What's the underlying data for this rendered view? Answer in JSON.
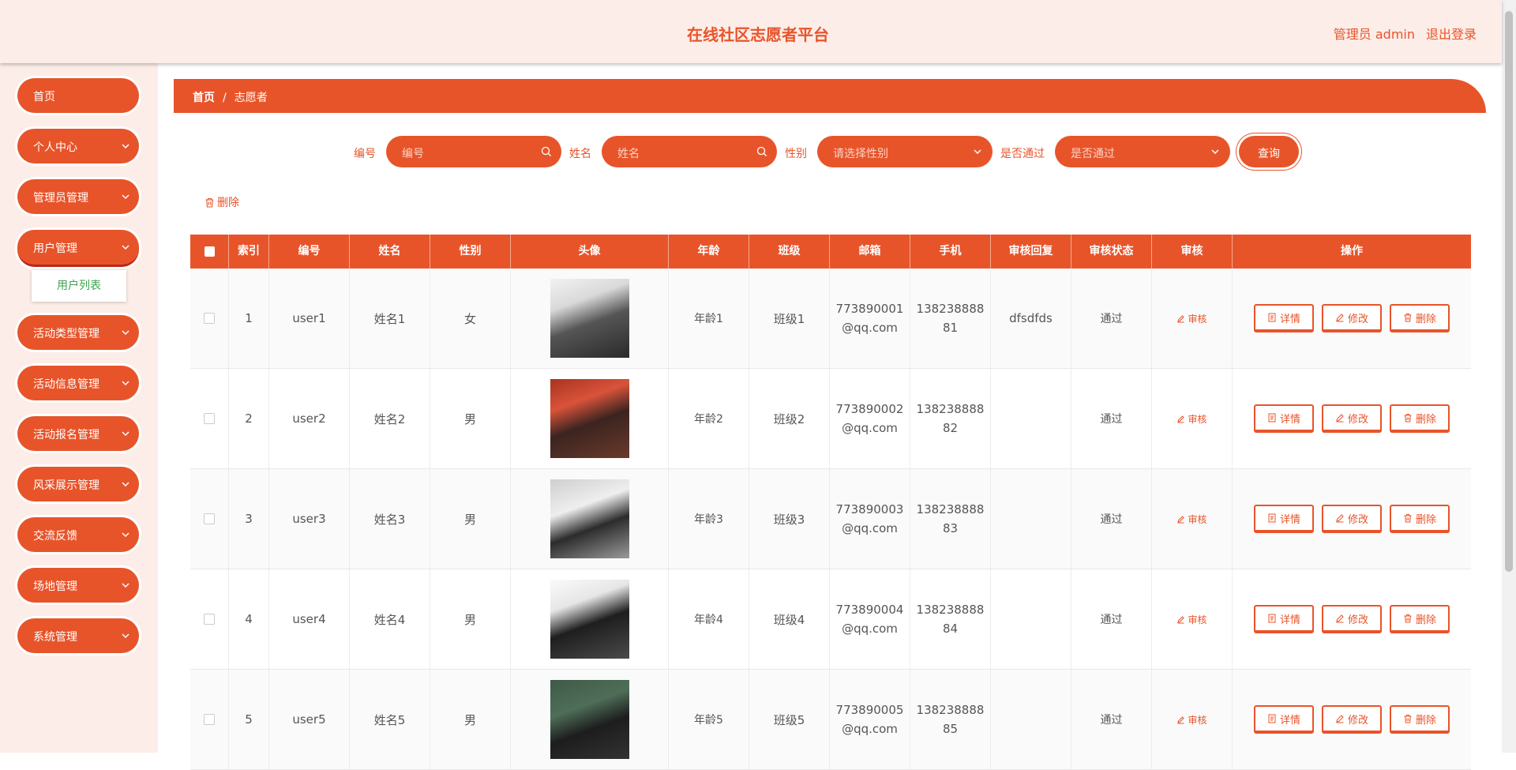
{
  "header": {
    "title": "在线社区志愿者平台",
    "user": "管理员 admin",
    "logout": "退出登录"
  },
  "colors": {
    "accent": "#e8542a",
    "bg_light": "#fcede8",
    "submenu_text": "#3aa54d"
  },
  "sidebar": {
    "items": [
      {
        "label": "首页",
        "has_chevron": false
      },
      {
        "label": "个人中心",
        "has_chevron": true
      },
      {
        "label": "管理员管理",
        "has_chevron": true
      },
      {
        "label": "用户管理",
        "has_chevron": true,
        "expanded": true
      },
      {
        "label": "活动类型管理",
        "has_chevron": true
      },
      {
        "label": "活动信息管理",
        "has_chevron": true
      },
      {
        "label": "活动报名管理",
        "has_chevron": true
      },
      {
        "label": "风采展示管理",
        "has_chevron": true
      },
      {
        "label": "交流反馈",
        "has_chevron": true
      },
      {
        "label": "场地管理",
        "has_chevron": true
      },
      {
        "label": "系统管理",
        "has_chevron": true
      }
    ],
    "submenu": {
      "label": "用户列表"
    }
  },
  "breadcrumb": {
    "home": "首页",
    "separator": "/",
    "current": "志愿者"
  },
  "search": {
    "id_label": "编号",
    "id_placeholder": "编号",
    "name_label": "姓名",
    "name_placeholder": "姓名",
    "gender_label": "性别",
    "gender_placeholder": "请选择性别",
    "passed_label": "是否通过",
    "passed_placeholder": "是否通过",
    "query_button": "查询"
  },
  "toolbar": {
    "delete_label": "删除"
  },
  "table": {
    "columns": [
      "",
      "索引",
      "编号",
      "姓名",
      "性别",
      "头像",
      "年龄",
      "班级",
      "邮箱",
      "手机",
      "审核回复",
      "审核状态",
      "审核",
      "操作"
    ],
    "actions": {
      "audit": "审核",
      "detail": "详情",
      "edit": "修改",
      "delete": "删除"
    },
    "rows": [
      {
        "index": "1",
        "id": "user1",
        "name": "姓名1",
        "gender": "女",
        "age": "年龄1",
        "class": "班级1",
        "email_1": "773890001",
        "email_2": "@qq.com",
        "phone_1": "138238888",
        "phone_2": "81",
        "reply": "dfsdfds",
        "status": "通过",
        "avatar": "avatar-photo-1"
      },
      {
        "index": "2",
        "id": "user2",
        "name": "姓名2",
        "gender": "男",
        "age": "年龄2",
        "class": "班级2",
        "email_1": "773890002",
        "email_2": "@qq.com",
        "phone_1": "138238888",
        "phone_2": "82",
        "reply": "",
        "status": "通过",
        "avatar": "avatar-photo-2"
      },
      {
        "index": "3",
        "id": "user3",
        "name": "姓名3",
        "gender": "男",
        "age": "年龄3",
        "class": "班级3",
        "email_1": "773890003",
        "email_2": "@qq.com",
        "phone_1": "138238888",
        "phone_2": "83",
        "reply": "",
        "status": "通过",
        "avatar": "avatar-photo-3"
      },
      {
        "index": "4",
        "id": "user4",
        "name": "姓名4",
        "gender": "男",
        "age": "年龄4",
        "class": "班级4",
        "email_1": "773890004",
        "email_2": "@qq.com",
        "phone_1": "138238888",
        "phone_2": "84",
        "reply": "",
        "status": "通过",
        "avatar": "avatar-photo-4"
      },
      {
        "index": "5",
        "id": "user5",
        "name": "姓名5",
        "gender": "男",
        "age": "年龄5",
        "class": "班级5",
        "email_1": "773890005",
        "email_2": "@qq.com",
        "phone_1": "138238888",
        "phone_2": "85",
        "reply": "",
        "status": "通过",
        "avatar": "avatar-photo-5"
      }
    ]
  }
}
